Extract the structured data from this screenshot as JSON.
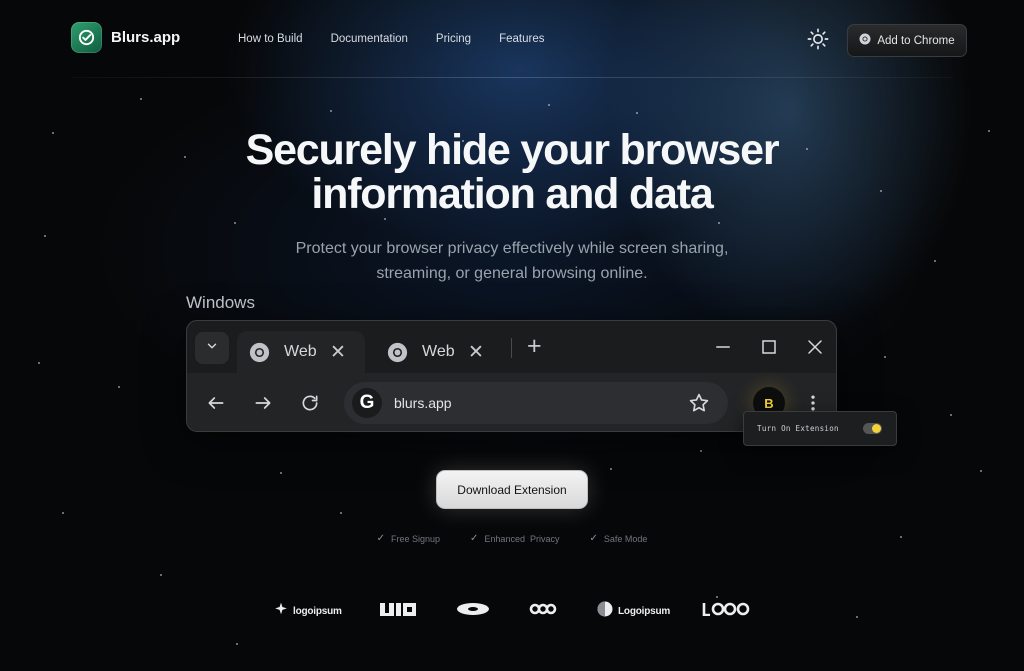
{
  "brand": {
    "name": "Blurs.app"
  },
  "nav": {
    "links": [
      "How to Build",
      "Documentation",
      "Pricing",
      "Features"
    ],
    "cta_label": "Add to Chrome"
  },
  "hero": {
    "title_line1": "Securely hide your browser",
    "title_line2": "information and data",
    "subtitle_line1": "Protect your browser privacy effectively while screen sharing,",
    "subtitle_line2": "streaming, or general browsing online."
  },
  "preview": {
    "os_label": "Windows",
    "tabs": [
      {
        "title": "Web",
        "close": "✕"
      },
      {
        "title": "Web",
        "close": "✕"
      }
    ],
    "new_tab": "+",
    "omnibox": {
      "engine_icon": "G",
      "url": "blurs.app"
    },
    "extension": {
      "avatar": "B",
      "popup_label": "Turn On Extension",
      "enabled": true
    }
  },
  "cta": {
    "label": "Download Extension"
  },
  "features": [
    "Free Signup",
    "Enhanced  Privacy",
    "Safe Mode"
  ],
  "logos": [
    {
      "icon": "sparkle-icon",
      "text": "logoipsum"
    },
    {
      "icon": "wordmark-icon",
      "text": ""
    },
    {
      "icon": "disc-icon",
      "text": ""
    },
    {
      "icon": "infinity-icon",
      "text": ""
    },
    {
      "icon": "sphere-icon",
      "text": "Logoipsum"
    },
    {
      "icon": "loop-icon",
      "text": ""
    }
  ],
  "colors": {
    "background": "#060708",
    "accent_green": "#2fa06f",
    "toggle_yellow": "#f2d43a",
    "cta_bg": "#e8e8e8"
  }
}
